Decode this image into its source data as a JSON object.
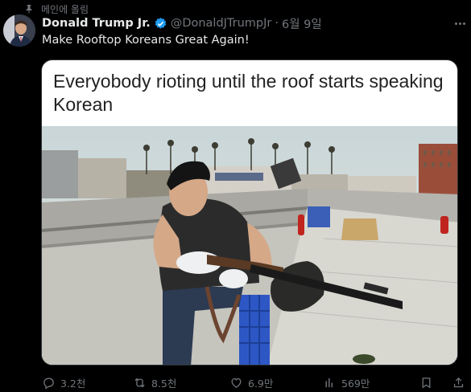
{
  "pinned": {
    "label": "메인에 올림",
    "icon": "pin-icon"
  },
  "author": {
    "name": "Donald Trump Jr.",
    "handle": "@DonaldJTrumpJr",
    "separator": "·",
    "date": "6월 9일",
    "verified_color": "#1d9bf0"
  },
  "tweet": {
    "text": "Make Rooftop Koreans Great Again!"
  },
  "media": {
    "caption": "Everyobody rioting until the roof starts speaking Korean"
  },
  "actions": {
    "replies": "3.2천",
    "retweets": "8.5천",
    "likes": "6.9만",
    "views": "569만"
  },
  "colors": {
    "background": "#000000",
    "text": "#e7e9ea",
    "muted": "#71767b",
    "accent": "#1d9bf0"
  }
}
